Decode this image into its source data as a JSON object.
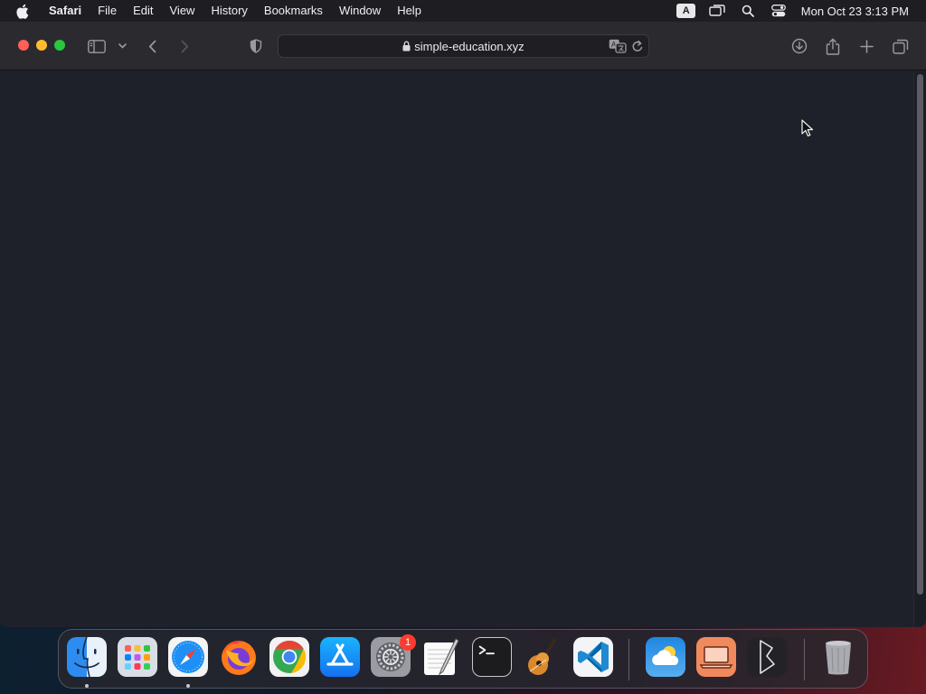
{
  "menubar": {
    "app_name": "Safari",
    "items": [
      "File",
      "Edit",
      "View",
      "History",
      "Bookmarks",
      "Window",
      "Help"
    ],
    "input_source": "A",
    "clock": "Mon Oct 23  3:13 PM"
  },
  "browser": {
    "url": "simple-education.xyz"
  },
  "dock": {
    "apps": [
      {
        "name": "Finder",
        "icon": "finder-icon",
        "running": true
      },
      {
        "name": "Launchpad",
        "icon": "launchpad-icon",
        "running": false
      },
      {
        "name": "Safari",
        "icon": "safari-icon",
        "running": true
      },
      {
        "name": "Firefox",
        "icon": "firefox-icon",
        "running": false
      },
      {
        "name": "Chrome",
        "icon": "chrome-icon",
        "running": false
      },
      {
        "name": "App Store",
        "icon": "app-store-icon",
        "running": false
      },
      {
        "name": "System Settings",
        "icon": "system-settings-icon",
        "running": false,
        "badge": "1"
      },
      {
        "name": "TextEdit",
        "icon": "textedit-icon",
        "running": false
      },
      {
        "name": "Terminal",
        "icon": "terminal-icon",
        "running": false
      },
      {
        "name": "GarageBand",
        "icon": "garageband-icon",
        "running": false
      },
      {
        "name": "VS Code",
        "icon": "vscode-icon",
        "running": false
      },
      {
        "name": "Weather",
        "icon": "weather-icon",
        "running": false
      },
      {
        "name": "Remote Desktop",
        "icon": "remote-desktop-icon",
        "running": false
      },
      {
        "name": "Bezel",
        "icon": "bezel-icon",
        "running": false
      },
      {
        "name": "Trash",
        "icon": "trash-icon",
        "running": false
      }
    ]
  },
  "colors": {
    "accent": "#0a84ff",
    "close": "#fe5f57",
    "minimize": "#febc2e",
    "maximize": "#28c840",
    "page_background": "#1f212a"
  }
}
